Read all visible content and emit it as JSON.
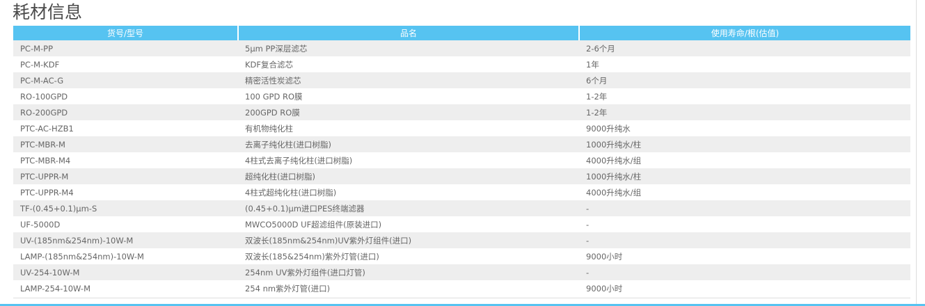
{
  "title": "耗材信息",
  "headers": [
    "货号/型号",
    "品名",
    "使用寿命/根(估值)"
  ],
  "rows": [
    [
      "PC-M-PP",
      "5μm PP深层滤芯",
      "2-6个月"
    ],
    [
      "PC-M-KDF",
      "KDF复合滤芯",
      "1年"
    ],
    [
      "PC-M-AC-G",
      "精密活性炭滤芯",
      "6个月"
    ],
    [
      "RO-100GPD",
      "100 GPD RO膜",
      "1-2年"
    ],
    [
      "RO-200GPD",
      "200GPD RO膜",
      "1-2年"
    ],
    [
      "PTC-AC-HZB1",
      "有机物纯化柱",
      "9000升纯水"
    ],
    [
      "PTC-MBR-M",
      "去离子纯化柱(进口树脂)",
      "1000升纯水/柱"
    ],
    [
      "PTC-MBR-M4",
      "4柱式去离子纯化柱(进口树脂)",
      "4000升纯水/组"
    ],
    [
      "PTC-UPPR-M",
      "超纯化柱(进口树脂)",
      "1000升纯水/柱"
    ],
    [
      "PTC-UPPR-M4",
      "4柱式超纯化柱(进口树脂)",
      "4000升纯水/组"
    ],
    [
      "TF-(0.45+0.1)μm-S",
      "(0.45+0.1)μm进口PES终端滤器",
      "-"
    ],
    [
      "UF-5000D",
      "MWCO5000D UF超滤组件(原装进口)",
      "-"
    ],
    [
      "UV-(185nm&254nm)-10W-M",
      "双波长(185nm&254nm)UV紫外灯组件(进口)",
      "-"
    ],
    [
      "LAMP-(185nm&254nm)-10W-M",
      "双波长(185&254nm)紫外灯管(进口)",
      "9000小时"
    ],
    [
      "UV-254-10W-M",
      "254nm UV紫外灯组件(进口灯管)",
      "-"
    ],
    [
      "LAMP-254-10W-M",
      "254 nm紫外灯管(进口)",
      "9000小时"
    ]
  ]
}
